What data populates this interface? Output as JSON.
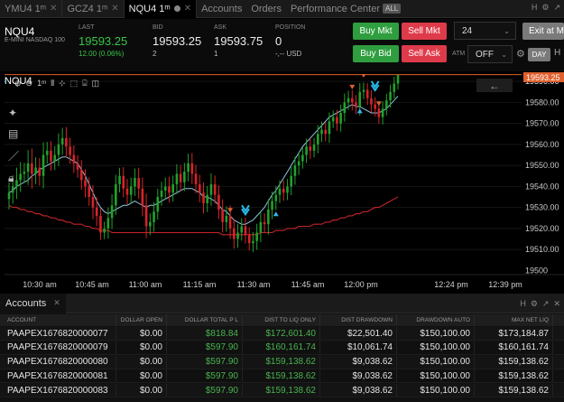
{
  "tabs": [
    {
      "label": "YMU4 1ᵐ",
      "active": false
    },
    {
      "label": "GCZ4 1ᵐ",
      "active": false
    },
    {
      "label": "NQU4 1ᵐ",
      "active": true
    },
    {
      "label": "Accounts",
      "active": false
    },
    {
      "label": "Orders",
      "active": false
    },
    {
      "label": "Performance Center",
      "active": false
    }
  ],
  "tabs_badge": "ALL",
  "quote": {
    "symbol": "NQU4",
    "desc": "E-MINI NASDAQ 100",
    "last_label": "LAST",
    "last": "19593.25",
    "change": "12.00 (0.06%)",
    "bid_label": "BID",
    "bid": "19593.25",
    "bid_size": "2",
    "ask_label": "ASK",
    "ask": "19593.75",
    "ask_size": "1",
    "pos_label": "POSITION",
    "pos": "0",
    "pos_sub": "-,-- USD"
  },
  "order": {
    "buy_mkt": "Buy Mkt",
    "sell_mkt": "Sell Mkt",
    "buy_bid": "Buy Bid",
    "sell_ask": "Sell Ask",
    "qty": "24",
    "exit": "Exit at M",
    "atm_label": "ATM",
    "atm": "OFF",
    "day": "DAY"
  },
  "chart_panel": {
    "symbol": "NQU4",
    "interval": "1ᵐ"
  },
  "chart_data": {
    "type": "candlestick",
    "price_label": "19593.25",
    "y_ticks": [
      19510,
      19520,
      19530,
      19540,
      19550,
      19560,
      19570,
      19580,
      19590
    ],
    "y_partial_ticks": [
      "19500",
      "19590.00"
    ],
    "x_ticks": [
      "10:30 am",
      "10:45 am",
      "11:00 am",
      "11:15 am",
      "11:30 am",
      "11:45 am",
      "12:00 pm",
      "12:24 pm",
      "12:39 pm"
    ],
    "ylim": [
      19500,
      19593.25
    ],
    "fast_ma_color": "#8ec7e0",
    "slow_ma_color": "#c4242a",
    "up_color": "#21a12c",
    "down_color": "#d8232a",
    "close": [
      19537,
      19540,
      19543,
      19546,
      19547,
      19551,
      19546,
      19549,
      19545,
      19555,
      19557,
      19552,
      19555,
      19560,
      19563,
      19559,
      19555,
      19551,
      19548,
      19543,
      19540,
      19535,
      19530,
      19526,
      19518,
      19520,
      19525,
      19531,
      19541,
      19545,
      19539,
      19536,
      19540,
      19544,
      19539,
      19531,
      19521,
      19523,
      19528,
      19535,
      19538,
      19540,
      19537,
      19541,
      19546,
      19542,
      19547,
      19551,
      19546,
      19541,
      19537,
      19532,
      19536,
      19541,
      19536,
      19529,
      19523,
      19526,
      19520,
      19515,
      19518,
      19521,
      19517,
      19513,
      19514,
      19518,
      19523,
      19522,
      19529,
      19533,
      19536,
      19539,
      19537,
      19540,
      19545,
      19550,
      19552,
      19555,
      19559,
      19557,
      19560,
      19565,
      19567,
      19565,
      19571,
      19573,
      19570,
      19575,
      19580,
      19582,
      19580,
      19578,
      19585,
      19586,
      19582,
      19579,
      19577,
      19573,
      19577,
      19581,
      19585,
      19589,
      19593.25
    ],
    "candle_range": [
      14,
      15,
      17,
      16,
      12,
      18,
      20,
      14,
      13,
      17,
      12,
      13,
      12,
      15,
      14,
      15,
      12,
      13,
      11,
      13,
      15,
      12,
      16,
      14,
      10,
      9,
      14,
      15,
      13,
      11,
      12,
      13,
      12,
      13,
      14,
      15,
      16,
      12,
      13,
      11,
      12,
      12,
      13,
      12,
      13,
      12,
      12,
      13,
      14,
      12,
      13,
      14,
      12,
      15,
      12,
      13,
      14,
      13,
      14,
      13,
      12,
      11,
      12,
      10,
      12,
      12,
      13,
      12,
      14,
      13,
      12,
      11,
      11,
      10,
      12,
      12,
      13,
      10,
      11,
      11,
      9,
      12,
      11,
      10,
      12,
      9,
      10,
      11,
      12,
      10,
      11,
      10,
      12,
      10,
      9,
      11,
      10,
      9,
      10,
      9,
      10,
      9,
      8
    ],
    "fast_ma": [
      19537,
      19538,
      19540,
      19541,
      19542,
      19543,
      19545,
      19546,
      19548,
      19549,
      19550,
      19551,
      19552,
      19553,
      19554,
      19554,
      19553,
      19552,
      19551,
      19548,
      19545,
      19541,
      19537,
      19533,
      19530,
      19528,
      19527,
      19528,
      19529,
      19530,
      19531,
      19531,
      19532,
      19533,
      19532,
      19531,
      19530,
      19531,
      19531,
      19532,
      19533,
      19534,
      19535,
      19536,
      19537,
      19538,
      19539,
      19539,
      19539,
      19538,
      19537,
      19535,
      19535,
      19534,
      19533,
      19531,
      19529,
      19528,
      19526,
      19524,
      19523,
      19522,
      19522,
      19523,
      19524,
      19526,
      19528,
      19530,
      19533,
      19536,
      19538,
      19541,
      19544,
      19547,
      19550,
      19553,
      19556,
      19559,
      19561,
      19563,
      19565,
      19567,
      19569,
      19571,
      19573,
      19574,
      19575,
      19576,
      19577,
      19578,
      19579,
      19578,
      19578,
      19577,
      19576,
      19575,
      19575,
      19575,
      19576,
      19577,
      19579,
      19581,
      19583
    ],
    "slow_ma": [
      19531,
      19530,
      19530,
      19529,
      19529,
      19528,
      19528,
      19527,
      19527,
      19526,
      19526,
      19525,
      19525,
      19524,
      19524,
      19523,
      19523,
      19522,
      19522,
      19522,
      19521,
      19521,
      19520,
      19520,
      19519,
      19519,
      19519,
      19518,
      19518,
      19518,
      19518,
      19518,
      19518,
      19518,
      19518,
      19518,
      19518,
      19518,
      19518,
      19518,
      19518,
      19518,
      19518,
      19518,
      19518,
      19518,
      19518,
      19518,
      19518,
      19518,
      19518,
      19518,
      19518,
      19518,
      19518,
      19518,
      19517,
      19517,
      19517,
      19517,
      19517,
      19517,
      19517,
      19517,
      19517,
      19517,
      19518,
      19518,
      19518,
      19518,
      19519,
      19519,
      19519,
      19520,
      19520,
      19520,
      19521,
      19521,
      19521,
      19521,
      19522,
      19522,
      19522,
      19523,
      19523,
      19524,
      19524,
      19525,
      19525,
      19526,
      19526,
      19527,
      19527,
      19528,
      19528,
      19529,
      19530,
      19530,
      19531,
      19532,
      19533,
      19534,
      19535
    ],
    "buy_arrow_index": [
      70,
      92
    ],
    "sell_arrow_index": [
      58,
      90,
      93,
      97
    ],
    "hover_arrow_index": [
      62,
      93,
      96
    ]
  },
  "accounts": {
    "title": "Accounts",
    "columns": [
      "ACCOUNT",
      "DOLLAR OPEN",
      "DOLLAR TOTAL P L",
      "DIST TO LIQ ONLY",
      "DIST DRAWDOWN",
      "DRAWDOWN AUTO",
      "MAX NET LIQ"
    ],
    "rows": [
      [
        "PAAPEX1676820000077",
        "$0.00",
        "$818.84",
        "$172,601.40",
        "$22,501.40",
        "$150,100.00",
        "$173,184.87"
      ],
      [
        "PAAPEX1676820000079",
        "$0.00",
        "$597.90",
        "$160,161.74",
        "$10,061.74",
        "$150,100.00",
        "$160,161.74"
      ],
      [
        "PAAPEX1676820000080",
        "$0.00",
        "$597.90",
        "$159,138.62",
        "$9,038.62",
        "$150,100.00",
        "$159,138.62"
      ],
      [
        "PAAPEX1676820000081",
        "$0.00",
        "$597.90",
        "$159,138.62",
        "$9,038.62",
        "$150,100.00",
        "$159,138.62"
      ],
      [
        "PAAPEX1676820000083",
        "$0.00",
        "$597.90",
        "$159,138.62",
        "$9,038.62",
        "$150,100.00",
        "$159,138.62"
      ]
    ]
  }
}
